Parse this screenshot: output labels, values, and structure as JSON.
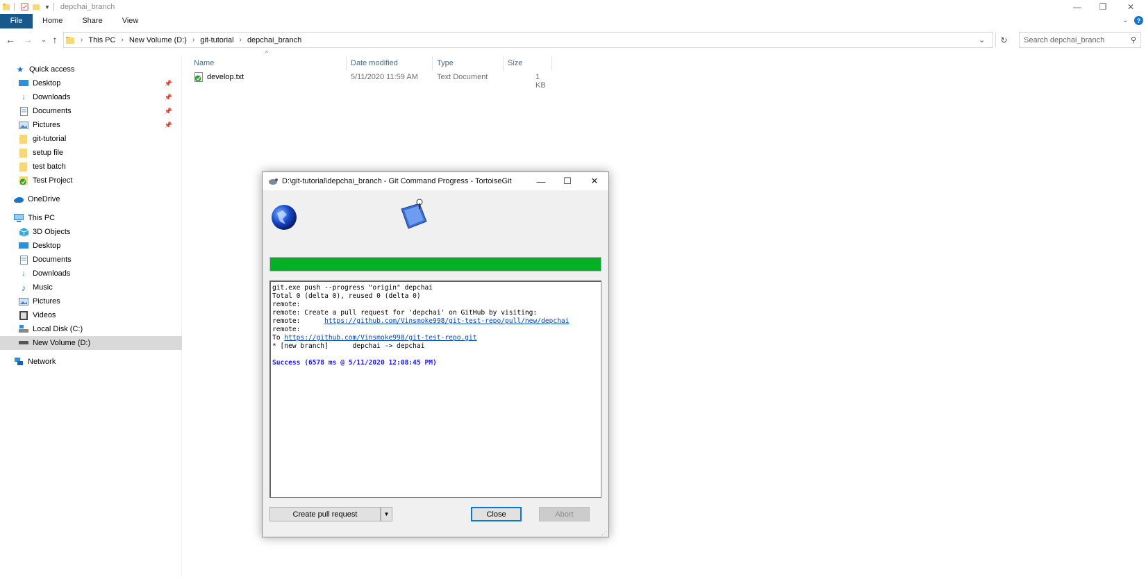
{
  "window": {
    "title": "depchai_branch",
    "controls": {
      "minimize": "—",
      "restore": "❐",
      "close": "✕"
    }
  },
  "ribbon": {
    "tabs": [
      "File",
      "Home",
      "Share",
      "View"
    ]
  },
  "address": {
    "crumbs": [
      "This PC",
      "New Volume (D:)",
      "git-tutorial",
      "depchai_branch"
    ],
    "search_placeholder": "Search depchai_branch"
  },
  "sidebar": {
    "quick_access": "Quick access",
    "quick_items": [
      {
        "label": "Desktop",
        "icon": "desktop-icon",
        "pinned": true
      },
      {
        "label": "Downloads",
        "icon": "downloads-icon",
        "pinned": true
      },
      {
        "label": "Documents",
        "icon": "documents-icon",
        "pinned": true
      },
      {
        "label": "Pictures",
        "icon": "pictures-icon",
        "pinned": true
      },
      {
        "label": "git-tutorial",
        "icon": "folder-icon",
        "pinned": false
      },
      {
        "label": "setup file",
        "icon": "folder-icon",
        "pinned": false
      },
      {
        "label": "test batch",
        "icon": "folder-icon",
        "pinned": false
      },
      {
        "label": "Test Project",
        "icon": "folder-git-icon",
        "pinned": false
      }
    ],
    "onedrive": "OneDrive",
    "this_pc": "This PC",
    "pc_items": [
      {
        "label": "3D Objects",
        "icon": "3d-objects-icon"
      },
      {
        "label": "Desktop",
        "icon": "desktop-icon"
      },
      {
        "label": "Documents",
        "icon": "documents-icon"
      },
      {
        "label": "Downloads",
        "icon": "downloads-icon"
      },
      {
        "label": "Music",
        "icon": "music-icon"
      },
      {
        "label": "Pictures",
        "icon": "pictures-icon"
      },
      {
        "label": "Videos",
        "icon": "videos-icon"
      },
      {
        "label": "Local Disk (C:)",
        "icon": "disk-icon"
      },
      {
        "label": "New Volume (D:)",
        "icon": "drive-icon",
        "selected": true
      }
    ],
    "network": "Network"
  },
  "files": {
    "columns": [
      "Name",
      "Date modified",
      "Type",
      "Size"
    ],
    "rows": [
      {
        "name": "develop.txt",
        "date": "5/11/2020 11:59 AM",
        "type": "Text Document",
        "size": "1 KB"
      }
    ]
  },
  "dialog": {
    "title": "D:\\git-tutorial\\depchai_branch - Git Command Progress - TortoiseGit",
    "progress": 1.0,
    "progress_color": "#06b025",
    "log": {
      "line1": "git.exe push --progress \"origin\" depchai",
      "line2": "Total 0 (delta 0), reused 0 (delta 0)",
      "line3": "remote:",
      "line4": "remote: Create a pull request for 'depchai' on GitHub by visiting:",
      "line5_prefix": "remote:      ",
      "line5_link": "https://github.com/Vinsmoke998/git-test-repo/pull/new/depchai",
      "line6": "remote:",
      "line7_prefix": "To ",
      "line7_link": "https://github.com/Vinsmoke998/git-test-repo.git",
      "line8": "* [new branch]      depchai -> depchai",
      "success": "Success (6578 ms @ 5/11/2020 12:08:45 PM)"
    },
    "buttons": {
      "create_pr": "Create pull request",
      "close": "Close",
      "abort": "Abort"
    }
  }
}
